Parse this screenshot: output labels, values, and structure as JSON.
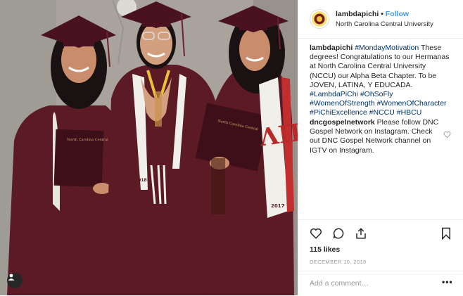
{
  "post": {
    "username": "lambdapichi",
    "follow_label": "Follow",
    "location": "North Carolina Central University",
    "separator": "•"
  },
  "caption": {
    "username": "lambdapichi",
    "tag1": "#MondayMotivation",
    "text1": " These degrees! Congratulations to our Hermanas at North Carolina Central University (NCCU) our Alpha Beta Chapter. To be JOVEN, LATINA, Y EDUCADA. ",
    "tag2": "#LambdaPiChi",
    "tag3": "#OhSoFly",
    "tag4": "#WomenOfStrength",
    "tag5": "#WomenOfCharacter",
    "tag6": "#PiChiExcellence",
    "tag7": "#NCCU",
    "tag8": "#HBCU"
  },
  "comment": {
    "username": "dncgospelnetwork",
    "text": " Please follow DNC Gospel Network on Instagram. Check out DNC Gospel Network channel on IGTV on Instagram."
  },
  "likes": "115 likes",
  "date": "DECEMBER 10, 2018",
  "add_comment_placeholder": "Add a comment…",
  "more_label": "•••",
  "photo": {
    "stole_letters": "ΛΠΧ",
    "stole_year": "2017",
    "gown_color": "#5b1a24",
    "cap_color": "#4a1220"
  },
  "icons": {
    "heart": "heart-icon",
    "comment": "comment-icon",
    "share": "share-icon",
    "save": "bookmark-icon",
    "user_tag": "person-icon"
  },
  "colors": {
    "link": "#003569",
    "follow": "#3897f0",
    "muted": "#999999"
  }
}
